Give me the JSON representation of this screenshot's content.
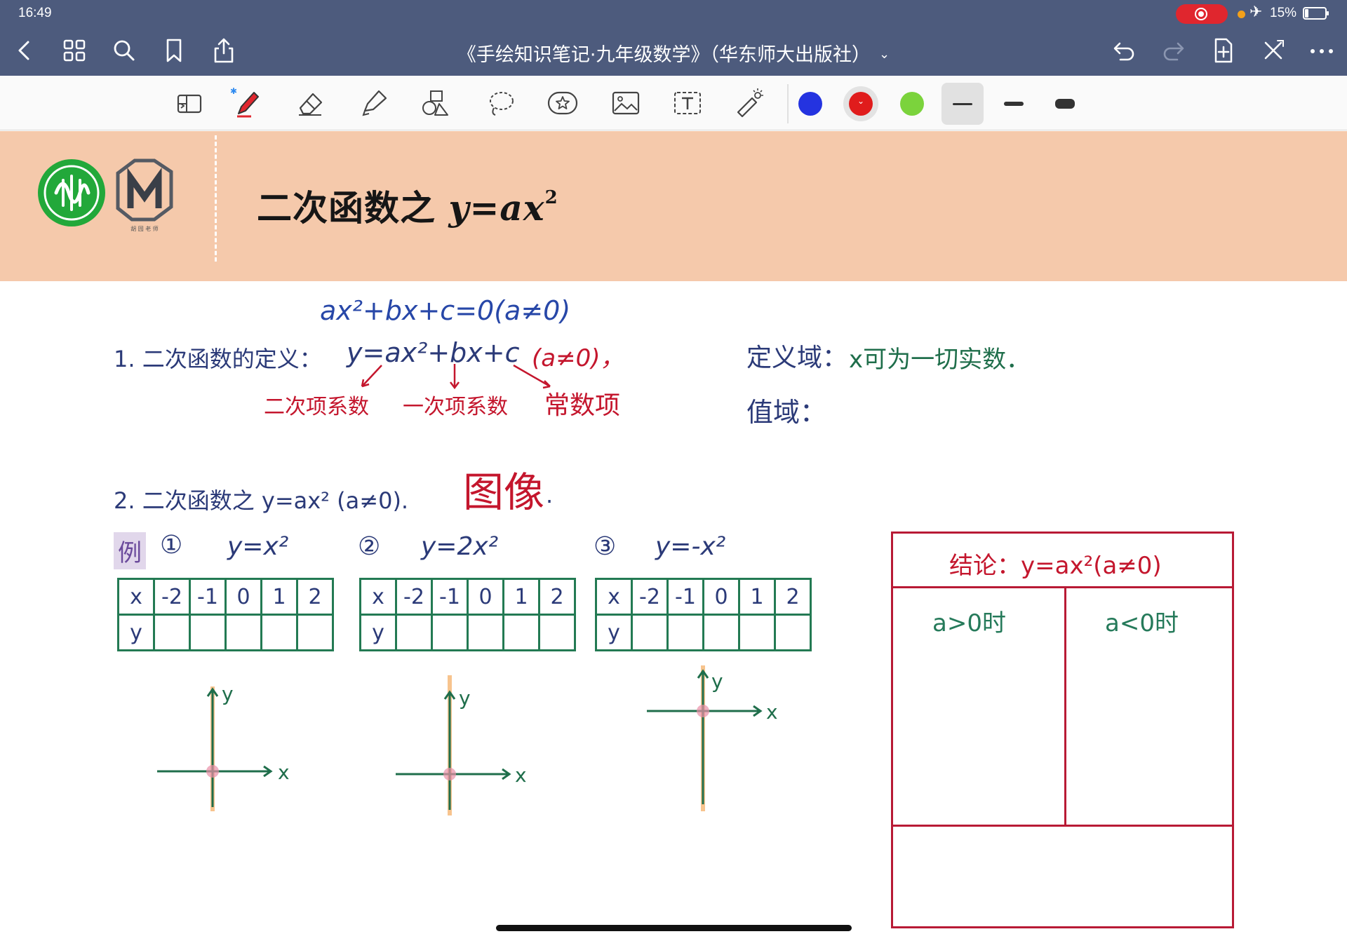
{
  "status_bar": {
    "time": "16:49",
    "battery_percent": "15%",
    "recording_color": "#e0262e"
  },
  "nav": {
    "document_title": "《手绘知识笔记·九年级数学》（华东师大出版社）",
    "title_caret": "⌄",
    "icons": [
      "back-icon",
      "grid-icon",
      "search-icon",
      "bookmark-icon",
      "share-icon",
      "undo-icon",
      "redo-icon",
      "add-page-icon",
      "close-icon",
      "more-icon"
    ]
  },
  "toolbar": {
    "tools": [
      "page-layout-icon",
      "pen-icon",
      "eraser-icon",
      "highlighter-icon",
      "shapes-icon",
      "lasso-icon",
      "sticker-icon",
      "image-icon",
      "text-icon",
      "laser-pointer-icon"
    ],
    "colors": [
      "#2433e0",
      "#e01c1c",
      "#7bd33c"
    ],
    "selected_color": "#e01c1c",
    "thickness_levels": [
      "thin",
      "medium",
      "thick"
    ],
    "selected_thickness": "thin"
  },
  "banner": {
    "title_text": "二次函数之 ",
    "title_formula": "y=ax",
    "title_exp": "2",
    "logo_m_caption": "胡 园 老 师",
    "bg_color": "#f5c9ab"
  },
  "notes": {
    "general_form": "ax²+bx+c=0(a≠0)",
    "def_label": "1. 二次函数的定义：",
    "def_formula": "y=ax²+bx+c",
    "def_condition": "(a≠0)，",
    "coef_quadratic": "二次项系数",
    "coef_linear": "一次项系数",
    "coef_constant": "常数项",
    "domain_label": "定义域：",
    "domain_text": "x可为一切实数．",
    "range_label": "值域：",
    "section2_text": "2. 二次函数之 y=ax²  (a≠0).",
    "section2_image": "图像",
    "section2_dot": ".",
    "example_label": "例"
  },
  "examples": [
    {
      "num": "①",
      "func": "y=x²",
      "x_header": "x",
      "y_header": "y",
      "x_values": [
        "-2",
        "-1",
        "0",
        "1",
        "2"
      ]
    },
    {
      "num": "②",
      "func": "y=2x²",
      "x_header": "x",
      "y_header": "y",
      "x_values": [
        "-2",
        "-1",
        "0",
        "1",
        "2"
      ]
    },
    {
      "num": "③",
      "func": "y=-x²",
      "x_header": "x",
      "y_header": "y",
      "x_values": [
        "-2",
        "-1",
        "0",
        "1",
        "2"
      ]
    }
  ],
  "axes_labels": {
    "x": "x",
    "y": "y"
  },
  "conclusion": {
    "title": "结论：y=ax²(a≠0)",
    "col_a_pos": "a>0时",
    "col_a_neg": "a<0时"
  }
}
